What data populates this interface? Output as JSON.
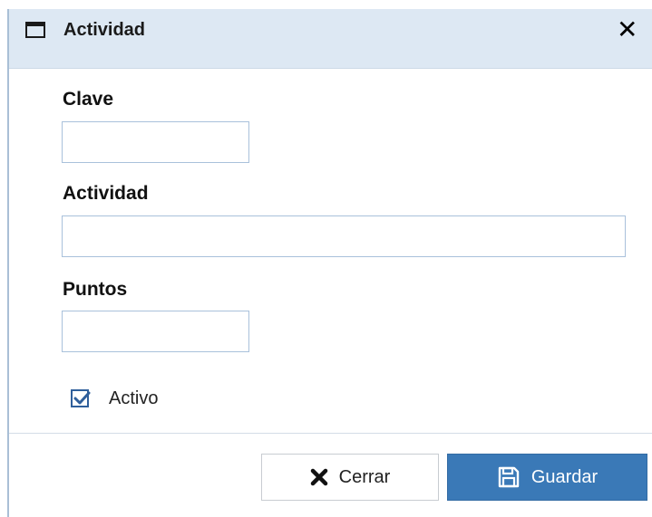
{
  "window": {
    "title": "Actividad"
  },
  "form": {
    "clave_label": "Clave",
    "clave_value": "",
    "actividad_label": "Actividad",
    "actividad_value": "",
    "puntos_label": "Puntos",
    "puntos_value": "",
    "activo_label": "Activo",
    "activo_checked": true
  },
  "footer": {
    "cerrar_label": "Cerrar",
    "guardar_label": "Guardar"
  },
  "icons": {
    "window": "window-icon",
    "close": "close-icon",
    "cerrar": "x-icon",
    "guardar": "save-icon",
    "check": "check-icon"
  },
  "colors": {
    "titlebar_bg": "#dde8f3",
    "primary_button": "#3a79b7",
    "input_border": "#a9c1db",
    "checkbox": "#2f5f9b"
  }
}
